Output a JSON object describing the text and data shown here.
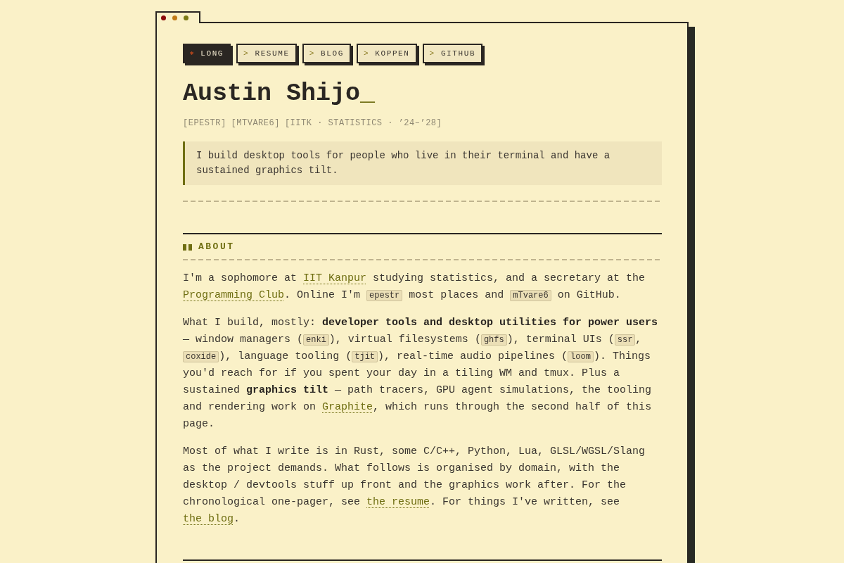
{
  "nav": [
    {
      "marker": "✱",
      "label": "LONG",
      "selected": true
    },
    {
      "marker": ">",
      "label": "RESUME",
      "selected": false
    },
    {
      "marker": ">",
      "label": "BLOG",
      "selected": false
    },
    {
      "marker": ">",
      "label": "KOPPEN",
      "selected": false
    },
    {
      "marker": ">",
      "label": "GITHUB",
      "selected": false
    }
  ],
  "header": {
    "name": "Austin Shijo",
    "cursor": "_",
    "tags": [
      "[EPESTR]",
      "[MTVARE6]",
      "[IITK · STATISTICS · ’24–’28]"
    ],
    "tagline": "I build desktop tools for people who live in their terminal and have a sustained graphics tilt."
  },
  "sections": [
    {
      "title": "ABOUT",
      "paragraphs": [
        [
          {
            "kind": "text",
            "text": "I'm a sophomore at "
          },
          {
            "kind": "link",
            "text": "IIT Kanpur"
          },
          {
            "kind": "text",
            "text": " studying statistics, and a secretary at the "
          },
          {
            "kind": "link",
            "text": "Programming Club"
          },
          {
            "kind": "text",
            "text": ". Online I'm "
          },
          {
            "kind": "code",
            "text": "epestr"
          },
          {
            "kind": "text",
            "text": " most places and "
          },
          {
            "kind": "code",
            "text": "mTvare6"
          },
          {
            "kind": "text",
            "text": " on GitHub."
          }
        ],
        [
          {
            "kind": "text",
            "text": "What I build, mostly: **developer tools and desktop utilities for power users** — window managers ("
          },
          {
            "kind": "code",
            "text": "enki"
          },
          {
            "kind": "text",
            "text": "), virtual filesystems ("
          },
          {
            "kind": "code",
            "text": "ghfs"
          },
          {
            "kind": "text",
            "text": "), terminal UIs ("
          },
          {
            "kind": "code",
            "text": "ssr"
          },
          {
            "kind": "text",
            "text": ", "
          },
          {
            "kind": "code",
            "text": "coxide"
          },
          {
            "kind": "text",
            "text": "), language tooling ("
          },
          {
            "kind": "code",
            "text": "tjit"
          },
          {
            "kind": "text",
            "text": "), real-time audio pipelines ("
          },
          {
            "kind": "code",
            "text": "loom"
          },
          {
            "kind": "text",
            "text": "). Things you'd reach for if you spent your day in a tiling WM and tmux. Plus a sustained **graphics tilt** — path tracers, GPU agent simulations, the tooling and rendering work on "
          },
          {
            "kind": "link",
            "text": "Graphite"
          },
          {
            "kind": "text",
            "text": ", which runs through the second half of this page."
          }
        ],
        [
          {
            "kind": "text",
            "text": "Most of what I write is in Rust, some C/C++, Python, Lua, GLSL/WGSL/Slang as the project demands. What follows is organised by domain, with the desktop / devtools stuff up front and the graphics work after. For the chronological one-pager, see "
          },
          {
            "kind": "link",
            "text": "the resume"
          },
          {
            "kind": "text",
            "text": ". For things I've written, see "
          },
          {
            "kind": "link",
            "text": "the blog"
          },
          {
            "kind": "text",
            "text": "."
          }
        ]
      ]
    }
  ]
}
